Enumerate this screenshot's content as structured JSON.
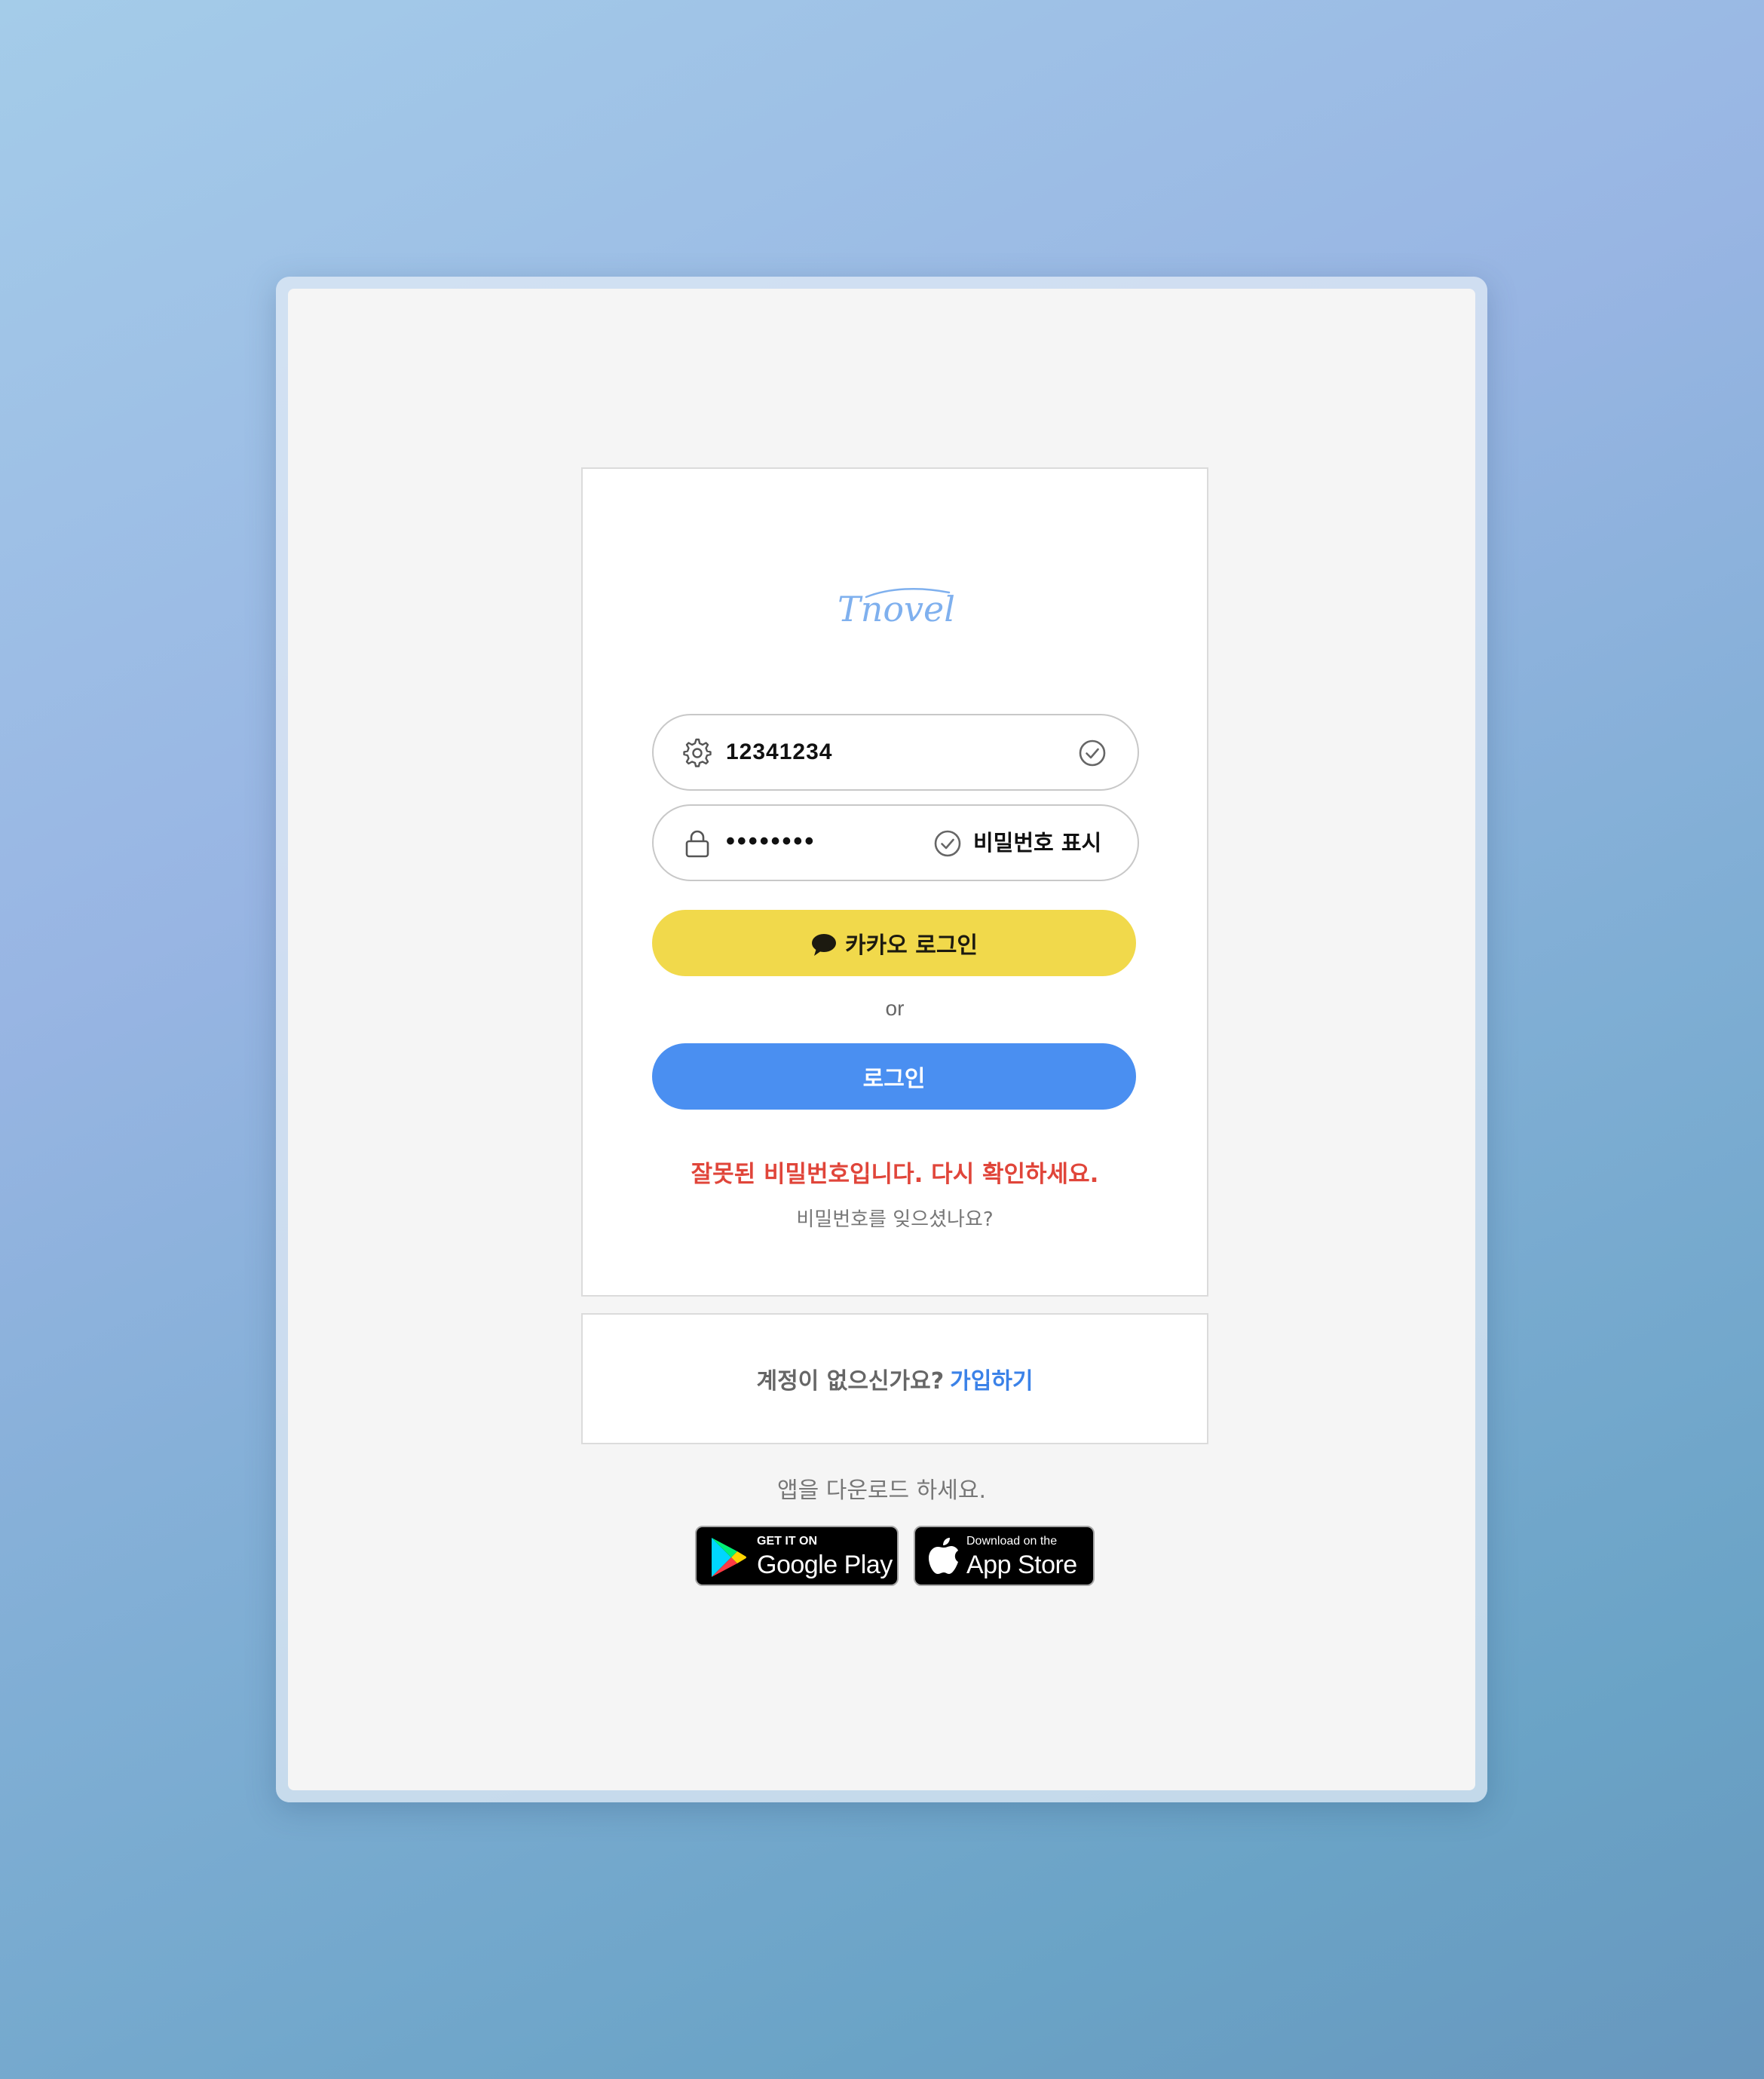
{
  "brand": {
    "logo_text": "Tnovel",
    "logo_color": "#7fb0ee"
  },
  "login_form": {
    "id_field": {
      "value": "12341234",
      "icon": "gear-icon",
      "status_icon": "check-circle-icon"
    },
    "password_field": {
      "masked_value": "••••••••",
      "icon": "lock-icon",
      "show_password_label": "비밀번호 표시",
      "show_password_icon": "check-circle-icon"
    },
    "kakao_button": {
      "label": "카카오 로그인",
      "icon": "chat-bubble-icon",
      "color": "#f1d94b"
    },
    "or_label": "or",
    "login_button": {
      "label": "로그인",
      "color": "#4a8ff1"
    },
    "error_message": "잘못된 비밀번호입니다. 다시 확인하세요.",
    "error_color": "#e0453a",
    "forgot_password_link": "비밀번호를 잊으셨나요?"
  },
  "signup": {
    "prompt": "계정이 없으신가요?",
    "link": "가입하기",
    "link_color": "#3b82e8"
  },
  "app_download": {
    "text": "앱을 다운로드 하세요.",
    "google_play": {
      "small_text": "GET IT ON",
      "large_text": "Google Play",
      "icon": "google-play-icon"
    },
    "app_store": {
      "small_text": "Download on the",
      "large_text": "App Store",
      "icon": "apple-icon"
    }
  }
}
